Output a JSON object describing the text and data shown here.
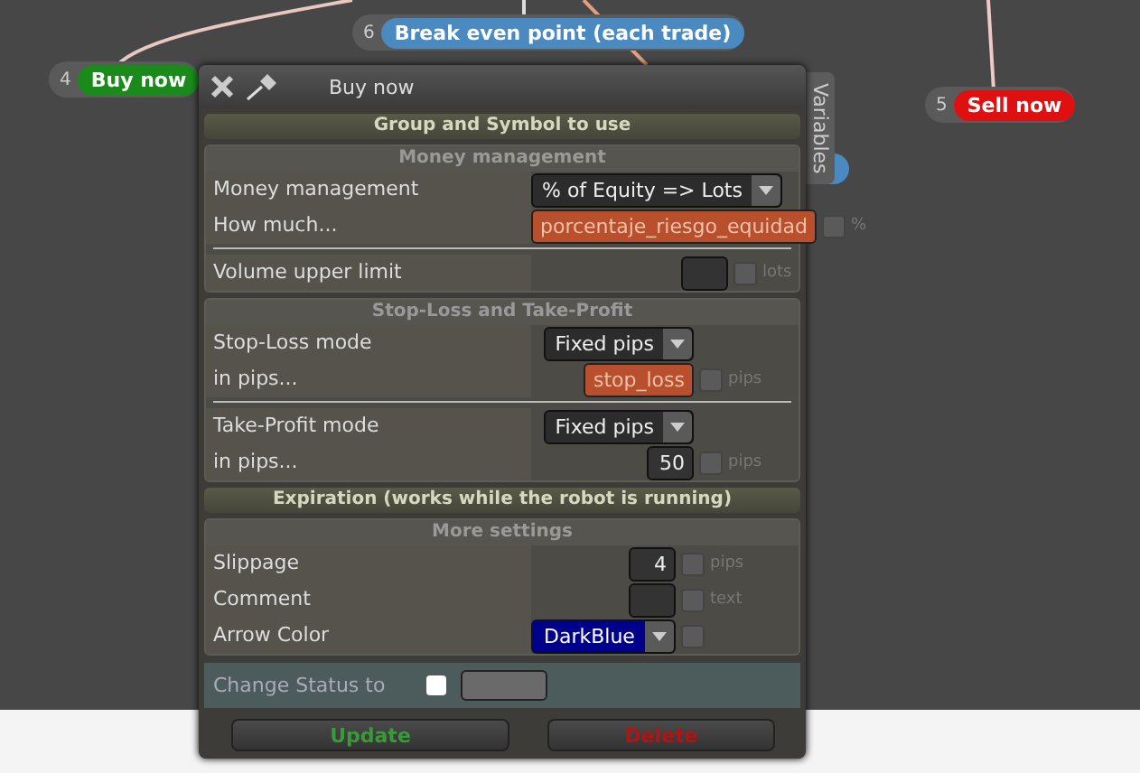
{
  "canvas": {
    "nodes": [
      {
        "number": "4",
        "label": "Buy now",
        "color": "#1a8a1a"
      },
      {
        "number": "6",
        "label": "Break even point (each trade)",
        "color": "#4a8ac0"
      },
      {
        "number": "5",
        "label": "Sell now",
        "color": "#e01010"
      }
    ]
  },
  "dialog": {
    "title": "Buy now",
    "side_tab": "Variables",
    "sections": [
      {
        "kind": "header",
        "title": "Group and Symbol to use"
      },
      {
        "kind": "group",
        "title": "Money management",
        "blocks": [
          [
            {
              "label": "Money management",
              "kind": "select",
              "value": "% of Equity => Lots"
            },
            {
              "label": "How much...",
              "kind": "variable",
              "value": "porcentaje_riesgo_equidad",
              "checked": false,
              "unit": "%"
            }
          ],
          [
            {
              "label": "Volume upper limit",
              "kind": "field",
              "checked": false,
              "unit": "lots"
            }
          ]
        ]
      },
      {
        "kind": "group",
        "title": "Stop-Loss and Take-Profit",
        "blocks": [
          [
            {
              "label": "Stop-Loss mode",
              "kind": "select",
              "value": "Fixed pips"
            },
            {
              "label": "in pips...",
              "kind": "variable",
              "value": "stop_loss",
              "checked": false,
              "unit": "pips"
            }
          ],
          [
            {
              "label": "Take-Profit mode",
              "kind": "select",
              "value": "Fixed pips"
            },
            {
              "label": "in pips...",
              "kind": "field",
              "value": "50",
              "checked": false,
              "unit": "pips"
            }
          ]
        ]
      },
      {
        "kind": "header",
        "title": "Expiration (works while the robot is running)"
      },
      {
        "kind": "group",
        "title": "More settings",
        "blocks": [
          [
            {
              "label": "Slippage",
              "kind": "field",
              "value": "4",
              "checked": false,
              "unit": "pips"
            },
            {
              "label": "Comment",
              "kind": "field",
              "checked": false,
              "unit": "text"
            },
            {
              "label": "Arrow Color",
              "kind": "color",
              "value": "DarkBlue",
              "checked": false
            }
          ]
        ]
      }
    ],
    "status": {
      "label": "Change Status to",
      "checked": false
    },
    "buttons": [
      {
        "label": "Update",
        "kind": "update"
      },
      {
        "label": "Delete",
        "kind": "delete"
      }
    ]
  }
}
